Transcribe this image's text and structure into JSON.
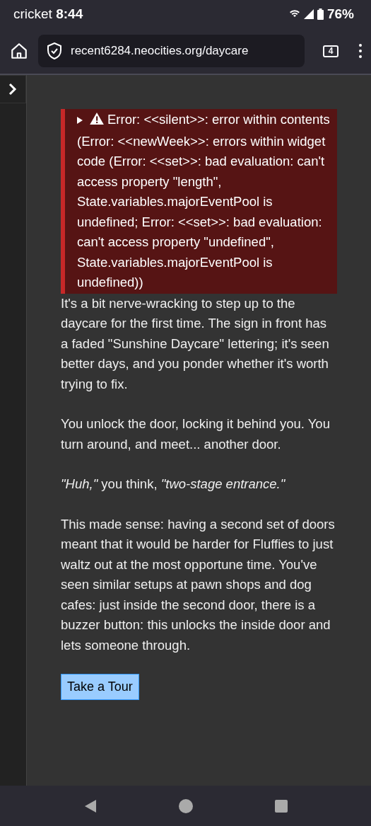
{
  "status_bar": {
    "carrier": "cricket",
    "time": "8:44",
    "battery": "76%"
  },
  "toolbar": {
    "url": "recent6284.neocities.org/daycare",
    "tab_count": "4"
  },
  "error": {
    "expanded": false,
    "message": "Error: <<silent>>: error within contents (Error: <<newWeek>>: errors within widget code (Error: <<set>>: bad evaluation: can't access property \"length\", State.variables.majorEventPool is undefined; Error: <<set>>: bad evaluation: can't access property \"undefined\", State.variables.majorEventPool is undefined))"
  },
  "paragraphs": [
    "It's a bit nerve-wracking to step up to the daycare for the first time. The sign in front has a faded \"Sunshine Daycare\" lettering; it's seen better days, and you ponder whether it's worth trying to fix.",
    "You unlock the door, locking it behind you. You turn around, and meet... another door.",
    "*\"Huh,\"* you think, *\"two-stage entrance.\"*",
    "This made sense: having a second set of doors meant that it would be harder for Fluffies to just waltz out at the most opportune time. You've seen similar setups at pawn shops and dog cafes: just inside the second door, there is a buzzer button: this unlocks the inside door and lets someone through."
  ],
  "link_button": "Take a Tour"
}
